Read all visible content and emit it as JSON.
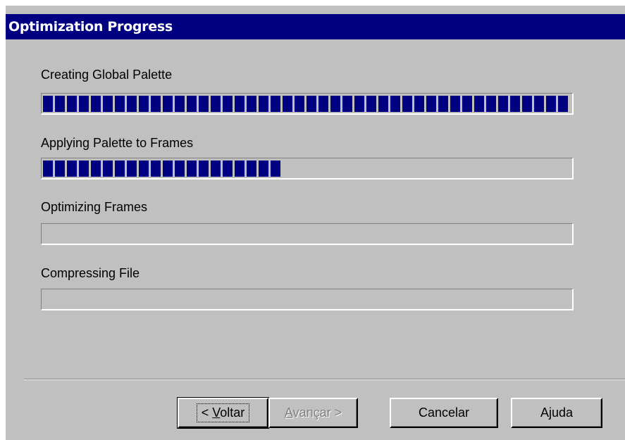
{
  "window": {
    "title": "Optimization Progress"
  },
  "steps": [
    {
      "label": "Creating Global Palette",
      "progress": 1.0
    },
    {
      "label": "Applying Palette to Frames",
      "progress": 0.45
    },
    {
      "label": "Optimizing Frames",
      "progress": 0.0
    },
    {
      "label": "Compressing File",
      "progress": 0.0
    }
  ],
  "buttons": {
    "back_prefix": "< ",
    "back_mnemonic": "V",
    "back_rest": "oltar",
    "next_mnemonic": "A",
    "next_rest": "vançar >",
    "cancel": "Cancelar",
    "help": "Ajuda"
  },
  "colors": {
    "title_bar": "#000080",
    "progress_fill": "#000080",
    "face": "#c0c0c0"
  }
}
